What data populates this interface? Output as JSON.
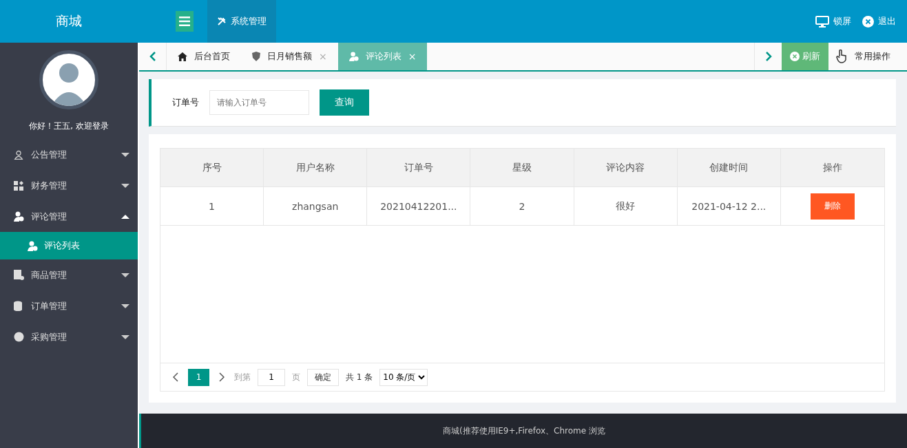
{
  "header": {
    "logo": "商城",
    "top_nav": [
      {
        "label": "系统管理",
        "selected": true
      }
    ],
    "actions": [
      {
        "kind": "lock",
        "label": "锁屏"
      },
      {
        "kind": "logout",
        "label": "退出"
      }
    ]
  },
  "sidebar": {
    "greeting": "你好！王五, 欢迎登录",
    "items": [
      {
        "kind": "user",
        "label": "公告管理",
        "expanded": false
      },
      {
        "kind": "grid",
        "label": "财务管理",
        "expanded": false
      },
      {
        "kind": "comment",
        "label": "评论管理",
        "expanded": true,
        "children": [
          {
            "label": "评论列表",
            "selected": true
          }
        ]
      },
      {
        "kind": "goods",
        "label": "商品管理",
        "expanded": false
      },
      {
        "kind": "order",
        "label": "订单管理",
        "expanded": false
      },
      {
        "kind": "purchase",
        "label": "采购管理",
        "expanded": false
      }
    ]
  },
  "tabs": [
    {
      "kind": "home",
      "label": "后台首页",
      "closable": false,
      "selected": false
    },
    {
      "kind": "shield",
      "label": "日月销售额",
      "closable": true,
      "selected": false
    },
    {
      "kind": "comment",
      "label": "评论列表",
      "closable": true,
      "selected": true
    }
  ],
  "tab_tools": {
    "close_mark": "×",
    "refresh": "刷新",
    "operations": "常用操作"
  },
  "search": {
    "label": "订单号",
    "placeholder": "请输入订单号",
    "button": "查询"
  },
  "table": {
    "columns": [
      "序号",
      "用户名称",
      "订单号",
      "星级",
      "评论内容",
      "创建时间",
      "操作"
    ],
    "rows": [
      {
        "cells": [
          "1",
          "zhangsan",
          "20210412201...",
          "2",
          "很好",
          "2021-04-12 2..."
        ],
        "action": "删除"
      }
    ]
  },
  "pagination": {
    "pages": [
      {
        "label": "1",
        "selected": true
      }
    ],
    "goto_label": "到第",
    "goto_value": "1",
    "page_unit": "页",
    "confirm": "确定",
    "total": "共 1 条",
    "page_size": "10 条/页"
  },
  "footer": "商城(推荐使用IE9+,Firefox、Chrome 浏览"
}
